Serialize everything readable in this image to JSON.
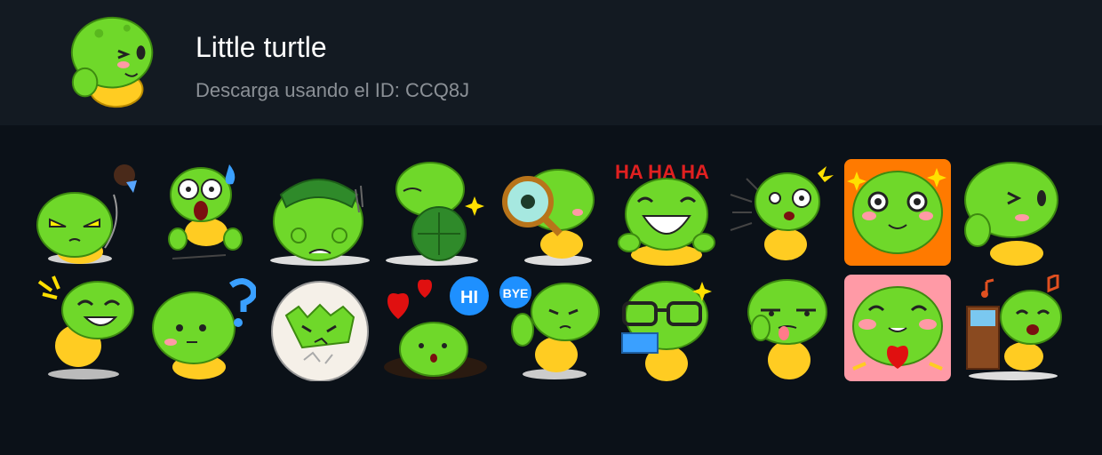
{
  "pack": {
    "title": "Little turtle",
    "subtitle": "Descarga usando el ID: CCQ8J"
  },
  "colors": {
    "header_bg": "#131a22",
    "page_bg": "#0b1118",
    "turtle_green": "#6fd82a",
    "shell_yellow": "#ffcc22",
    "title_text": "#ffffff",
    "subtitle_text": "#8b9096"
  },
  "stickers": [
    {
      "name": "angry-cupcake"
    },
    {
      "name": "shocked-sweat"
    },
    {
      "name": "hiding-in-shell"
    },
    {
      "name": "back-view-sparkle"
    },
    {
      "name": "magnifier"
    },
    {
      "name": "laughing-haha",
      "text": "HA HA HA"
    },
    {
      "name": "surprised-lines"
    },
    {
      "name": "begging-sparkle"
    },
    {
      "name": "wink-thumb"
    },
    {
      "name": "laughing-tears"
    },
    {
      "name": "confused-question"
    },
    {
      "name": "hatching-egg"
    },
    {
      "name": "hi-hearts",
      "text": "HI"
    },
    {
      "name": "bye-wave",
      "text": "BYE"
    },
    {
      "name": "glasses-book"
    },
    {
      "name": "tongue-out"
    },
    {
      "name": "heart-hands"
    },
    {
      "name": "singing-music"
    }
  ]
}
